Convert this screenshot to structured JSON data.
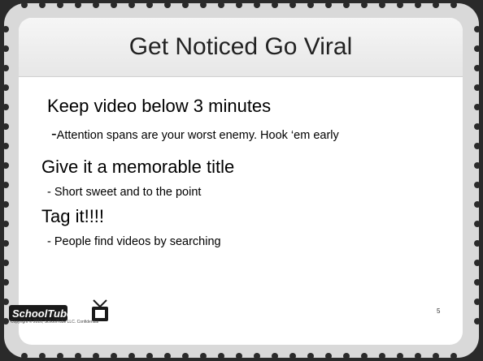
{
  "slide": {
    "title": "Get Noticed Go Viral",
    "bullets": [
      {
        "heading": "Keep video below 3 minutes",
        "detail_dash": "-",
        "detail": "Attention spans are your worst enemy. Hook ‘em early"
      },
      {
        "heading": "Give it a memorable title",
        "detail": "- Short sweet and to the point"
      },
      {
        "heading": "Tag it!!!!",
        "detail": "- People find videos by searching"
      }
    ]
  },
  "footer": {
    "logo_text": "SchoolTube",
    "copyright": "Copyright © 2010, SchoolTube LLC. Confidential",
    "page_number": "5"
  },
  "colors": {
    "background": "#2a2a2a",
    "frame_ring": "#d8d8d8",
    "panel": "#ffffff",
    "title_bar": "#eeeeee",
    "text": "#000000"
  }
}
